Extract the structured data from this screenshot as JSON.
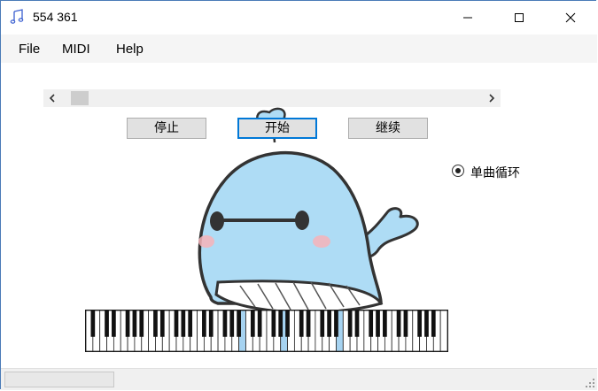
{
  "window": {
    "title": "554 361",
    "icon": "music-note-icon",
    "controls": [
      "minimize-icon",
      "maximize-icon",
      "close-icon"
    ]
  },
  "menu": {
    "items": [
      {
        "label": "File"
      },
      {
        "label": "MIDI"
      },
      {
        "label": "Help"
      }
    ]
  },
  "scrollbar": {
    "left_icon": "chevron-left-icon",
    "right_icon": "chevron-right-icon",
    "position": 0.03
  },
  "buttons": {
    "stop": "停止",
    "start": "开始",
    "continue": "继续"
  },
  "loop_option": {
    "label": "单曲循环",
    "checked": true
  },
  "mascot": "whale-illustration",
  "piano": {
    "white_keys": 52,
    "highlighted_white_keys": [
      22,
      28,
      36
    ],
    "highlight_color": "#a6d3f1"
  },
  "colors": {
    "accent": "#0078d7",
    "whale_body": "#aedcf5",
    "outline": "#333333"
  }
}
